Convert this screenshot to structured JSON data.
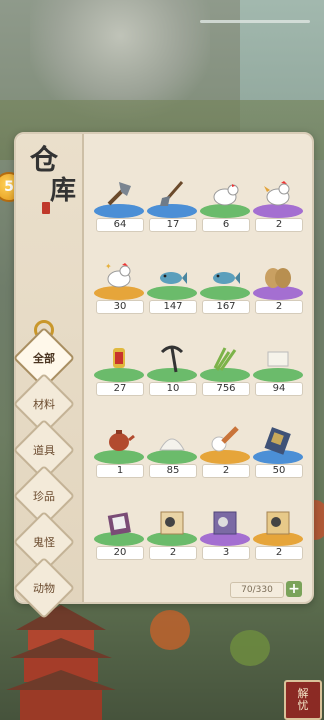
{
  "panel": {
    "title_char1": "仓",
    "title_char2": "库",
    "capacity": "70/330",
    "add_symbol": "+"
  },
  "tabs": [
    {
      "label": "全部",
      "active": true
    },
    {
      "label": "材料",
      "active": false
    },
    {
      "label": "道具",
      "active": false
    },
    {
      "label": "珍品",
      "active": false
    },
    {
      "label": "鬼怪",
      "active": false
    },
    {
      "label": "动物",
      "active": false
    }
  ],
  "items": [
    {
      "icon": "axe-icon",
      "count": "64",
      "pad": "#4b8fd6"
    },
    {
      "icon": "shovel-icon",
      "count": "17",
      "pad": "#4b8fd6"
    },
    {
      "icon": "hen-icon",
      "count": "6",
      "pad": "#6bbb6b"
    },
    {
      "icon": "rooster-icon",
      "count": "2",
      "pad": "#a46fd1"
    },
    {
      "icon": "rooster-sparkle-icon",
      "count": "30",
      "pad": "#e6a53a"
    },
    {
      "icon": "fish-icon",
      "count": "147",
      "pad": "#6bbb6b"
    },
    {
      "icon": "fish-icon",
      "count": "167",
      "pad": "#6bbb6b"
    },
    {
      "icon": "straw-sandals-icon",
      "count": "2",
      "pad": "#a46fd1"
    },
    {
      "icon": "talisman-bottle-icon",
      "count": "27",
      "pad": "#6bbb6b"
    },
    {
      "icon": "pickaxe-icon",
      "count": "10",
      "pad": "#6bbb6b"
    },
    {
      "icon": "scallion-icon",
      "count": "756",
      "pad": "#6bbb6b"
    },
    {
      "icon": "tofu-icon",
      "count": "94",
      "pad": "#6bbb6b"
    },
    {
      "icon": "teapot-icon",
      "count": "1",
      "pad": "#6bbb6b"
    },
    {
      "icon": "salt-pile-icon",
      "count": "85",
      "pad": "#6bbb6b"
    },
    {
      "icon": "pestle-icon",
      "count": "2",
      "pad": "#e6a53a"
    },
    {
      "icon": "book-icon",
      "count": "50",
      "pad": "#4b8fd6"
    },
    {
      "icon": "portrait-book-icon",
      "count": "20",
      "pad": "#6bbb6b"
    },
    {
      "icon": "scroll-villager-icon",
      "count": "2",
      "pad": "#6bbb6b"
    },
    {
      "icon": "scroll-worker-icon",
      "count": "3",
      "pad": "#a46fd1"
    },
    {
      "icon": "scroll-merchant-icon",
      "count": "2",
      "pad": "#e6a53a"
    }
  ],
  "side_coin": {
    "icon": "coin-icon",
    "symbol": "5"
  },
  "corner_button": {
    "line1": "解",
    "line2": "忧"
  }
}
